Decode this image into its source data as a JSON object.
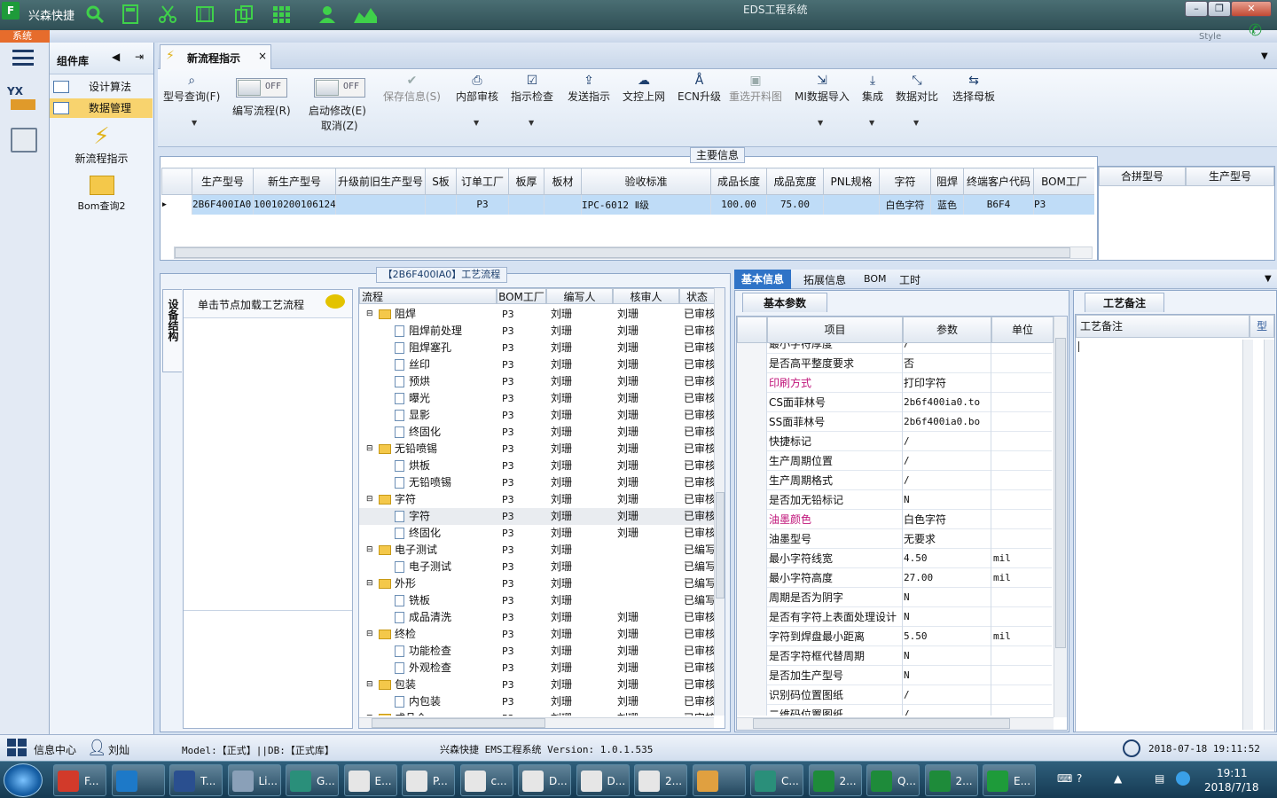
{
  "titlebar": {
    "app_name": "兴森快捷",
    "window_title": "EDS工程系统",
    "style_label": "Style"
  },
  "menubar": {
    "system_label": "系统"
  },
  "component_lib": {
    "title": "组件库",
    "items": [
      {
        "label": "设计算法"
      },
      {
        "label": "数据管理"
      }
    ],
    "tiles": [
      {
        "label": "新流程指示"
      },
      {
        "label": "Bom查询2"
      }
    ]
  },
  "doc_tab": {
    "label": "新流程指示",
    "close": "×"
  },
  "ribbon": {
    "model_query": "型号查询(F)",
    "toggles": [
      {
        "state": "OFF",
        "label": "编写流程(R)"
      },
      {
        "state": "OFF",
        "label": "启动修改(E)",
        "sub": "取消(Z)"
      }
    ],
    "buttons": [
      {
        "label": "保存信息(S)",
        "disabled": true
      },
      {
        "label": "内部审核"
      },
      {
        "label": "指示检查"
      },
      {
        "label": "发送指示"
      },
      {
        "label": "文控上网"
      },
      {
        "label": "ECN升级"
      },
      {
        "label": "重选开料图",
        "disabled": true
      },
      {
        "label": "MI数据导入"
      },
      {
        "label": "集成"
      },
      {
        "label": "数据对比"
      },
      {
        "label": "选择母板"
      }
    ]
  },
  "main_info": {
    "title": "主要信息",
    "columns": [
      "生产型号",
      "新生产型号",
      "升级前旧生产型号",
      "S板",
      "订单工厂",
      "板厚",
      "板材",
      "验收标准",
      "成品长度",
      "成品宽度",
      "PNL规格",
      "字符",
      "阻焊",
      "终端客户代码",
      "BOM工厂"
    ],
    "row": [
      "2B6F400IA0",
      "10010200106124",
      "",
      "",
      "P3",
      "",
      "",
      "IPC-6012 Ⅱ级",
      "100.00",
      "75.00",
      "",
      "白色字符",
      "蓝色",
      "B6F4",
      "P3"
    ],
    "side_columns": [
      "合拼型号",
      "生产型号"
    ]
  },
  "process": {
    "title": "【2B6F400IA0】工艺流程",
    "vertical_tab": "设备结构",
    "hint": "单击节点加载工艺流程",
    "columns": [
      "流程",
      "BOM工厂",
      "编写人",
      "核审人",
      "状态"
    ],
    "rows": [
      {
        "name": "阻焊",
        "lvl": 0,
        "bom": "P3",
        "w": "刘珊",
        "r": "刘珊",
        "s": "已审核"
      },
      {
        "name": "阻焊前处理",
        "lvl": 1,
        "bom": "P3",
        "w": "刘珊",
        "r": "刘珊",
        "s": "已审核"
      },
      {
        "name": "阻焊塞孔",
        "lvl": 1,
        "bom": "P3",
        "w": "刘珊",
        "r": "刘珊",
        "s": "已审核"
      },
      {
        "name": "丝印",
        "lvl": 1,
        "bom": "P3",
        "w": "刘珊",
        "r": "刘珊",
        "s": "已审核"
      },
      {
        "name": "预烘",
        "lvl": 1,
        "bom": "P3",
        "w": "刘珊",
        "r": "刘珊",
        "s": "已审核"
      },
      {
        "name": "曝光",
        "lvl": 1,
        "bom": "P3",
        "w": "刘珊",
        "r": "刘珊",
        "s": "已审核"
      },
      {
        "name": "显影",
        "lvl": 1,
        "bom": "P3",
        "w": "刘珊",
        "r": "刘珊",
        "s": "已审核"
      },
      {
        "name": "终固化",
        "lvl": 1,
        "bom": "P3",
        "w": "刘珊",
        "r": "刘珊",
        "s": "已审核"
      },
      {
        "name": "无铅喷锡",
        "lvl": 0,
        "bom": "P3",
        "w": "刘珊",
        "r": "刘珊",
        "s": "已审核"
      },
      {
        "name": "烘板",
        "lvl": 1,
        "bom": "P3",
        "w": "刘珊",
        "r": "刘珊",
        "s": "已审核"
      },
      {
        "name": "无铅喷锡",
        "lvl": 1,
        "bom": "P3",
        "w": "刘珊",
        "r": "刘珊",
        "s": "已审核"
      },
      {
        "name": "字符",
        "lvl": 0,
        "bom": "P3",
        "w": "刘珊",
        "r": "刘珊",
        "s": "已审核"
      },
      {
        "name": "字符",
        "lvl": 1,
        "bom": "P3",
        "w": "刘珊",
        "r": "刘珊",
        "s": "已审核"
      },
      {
        "name": "终固化",
        "lvl": 1,
        "bom": "P3",
        "w": "刘珊",
        "r": "刘珊",
        "s": "已审核"
      },
      {
        "name": "电子测试",
        "lvl": 0,
        "bom": "P3",
        "w": "刘珊",
        "r": "",
        "s": "已编写"
      },
      {
        "name": "电子测试",
        "lvl": 1,
        "bom": "P3",
        "w": "刘珊",
        "r": "",
        "s": "已编写"
      },
      {
        "name": "外形",
        "lvl": 0,
        "bom": "P3",
        "w": "刘珊",
        "r": "",
        "s": "已编写"
      },
      {
        "name": "铣板",
        "lvl": 1,
        "bom": "P3",
        "w": "刘珊",
        "r": "",
        "s": "已编写"
      },
      {
        "name": "成品清洗",
        "lvl": 1,
        "bom": "P3",
        "w": "刘珊",
        "r": "刘珊",
        "s": "已审核"
      },
      {
        "name": "终检",
        "lvl": 0,
        "bom": "P3",
        "w": "刘珊",
        "r": "刘珊",
        "s": "已审核"
      },
      {
        "name": "功能检查",
        "lvl": 1,
        "bom": "P3",
        "w": "刘珊",
        "r": "刘珊",
        "s": "已审核"
      },
      {
        "name": "外观检查",
        "lvl": 1,
        "bom": "P3",
        "w": "刘珊",
        "r": "刘珊",
        "s": "已审核"
      },
      {
        "name": "包装",
        "lvl": 0,
        "bom": "P3",
        "w": "刘珊",
        "r": "刘珊",
        "s": "已审核"
      },
      {
        "name": "内包装",
        "lvl": 1,
        "bom": "P3",
        "w": "刘珊",
        "r": "刘珊",
        "s": "已审核"
      },
      {
        "name": "成品仓",
        "lvl": 0,
        "bom": "P3",
        "w": "刘珊",
        "r": "刘珊",
        "s": "已审核"
      }
    ]
  },
  "props": {
    "tabs": [
      "基本信息",
      "拓展信息",
      "BOM",
      "工时"
    ],
    "subtab": "基本参数",
    "columns": [
      "项目",
      "参数",
      "单位"
    ],
    "rows": [
      {
        "item": "最小字符厚度",
        "val": "/",
        "unit": "",
        "hl": false
      },
      {
        "item": "是否高平整度要求",
        "val": "否",
        "unit": "",
        "hl": false
      },
      {
        "item": "印刷方式",
        "val": "打印字符",
        "unit": "",
        "hl": true
      },
      {
        "item": "CS面菲林号",
        "val": "2b6f400ia0.to",
        "unit": "",
        "hl": false
      },
      {
        "item": "SS面菲林号",
        "val": "2b6f400ia0.bo",
        "unit": "",
        "hl": false
      },
      {
        "item": "快捷标记",
        "val": "/",
        "unit": "",
        "hl": false
      },
      {
        "item": "生产周期位置",
        "val": "/",
        "unit": "",
        "hl": false
      },
      {
        "item": "生产周期格式",
        "val": "/",
        "unit": "",
        "hl": false
      },
      {
        "item": "是否加无铅标记",
        "val": "N",
        "unit": "",
        "hl": false
      },
      {
        "item": "油墨颜色",
        "val": "白色字符",
        "unit": "",
        "hl": true
      },
      {
        "item": "油墨型号",
        "val": "无要求",
        "unit": "",
        "hl": false
      },
      {
        "item": "最小字符线宽",
        "val": "4.50",
        "unit": "mil",
        "hl": false
      },
      {
        "item": "最小字符高度",
        "val": "27.00",
        "unit": "mil",
        "hl": false
      },
      {
        "item": "周期是否为阴字",
        "val": "N",
        "unit": "",
        "hl": false
      },
      {
        "item": "是否有字符上表面处理设计",
        "val": "N",
        "unit": "",
        "hl": false
      },
      {
        "item": "字符到焊盘最小距离",
        "val": "5.50",
        "unit": "mil",
        "hl": false
      },
      {
        "item": "是否字符框代替周期",
        "val": "N",
        "unit": "",
        "hl": false
      },
      {
        "item": "是否加生产型号",
        "val": "N",
        "unit": "",
        "hl": false
      },
      {
        "item": "识别码位置图纸",
        "val": "/",
        "unit": "",
        "hl": false
      },
      {
        "item": "二维码位置图纸",
        "val": "/",
        "unit": "",
        "hl": false
      }
    ]
  },
  "remark": {
    "tab": "工艺备注",
    "col1": "工艺备注",
    "col2": "型"
  },
  "status": {
    "info_center": "信息中心",
    "user": "刘灿",
    "model": "Model:【正式】||DB:【正式库】",
    "system": "兴森快捷 EMS工程系统 Version: 1.0.1.535",
    "datetime": "2018-07-18 19:11:52"
  },
  "taskbar": {
    "items": [
      "F...",
      "",
      "T...",
      "Li...",
      "G...",
      "E...",
      "P...",
      "c...",
      "D...",
      "D...",
      "2...",
      "",
      "C...",
      "2...",
      "Q...",
      "2...",
      "E..."
    ],
    "time": "19:11",
    "date": "2018/7/18"
  },
  "colors": {
    "accent": "#0a62c8",
    "selection": "#bfdcf7",
    "highlight_text": "#c0147a",
    "title_green": "#2f4f55"
  }
}
